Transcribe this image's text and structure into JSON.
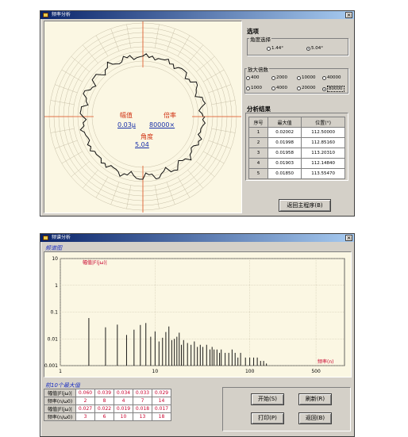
{
  "roundness_window": {
    "title": "频率分析",
    "close_label": "×",
    "polar": {
      "labels": [
        "幅值",
        "倍率",
        "角度"
      ],
      "values": [
        "0.03μ",
        "80000×",
        "5.04"
      ]
    },
    "options_title": "选项",
    "angle_group": {
      "label": "角度选择",
      "options": [
        "1.44°",
        "5.04°"
      ],
      "selected_index": 1
    },
    "magnification_group": {
      "label": "放大倍数",
      "row1": [
        "400",
        "2000",
        "10000",
        "40000"
      ],
      "row2": [
        "1000",
        "4000",
        "20000",
        "80000"
      ],
      "selected": "80000"
    },
    "results_title": "分析结果",
    "table_headers": [
      "序号",
      "最大值",
      "位置(°)"
    ],
    "table_rows": [
      [
        "1",
        "0.02002",
        "112.50000"
      ],
      [
        "2",
        "0.01998",
        "112.85160"
      ],
      [
        "3",
        "0.01958",
        "113.20310"
      ],
      [
        "4",
        "0.01903",
        "112.14840"
      ],
      [
        "5",
        "0.01850",
        "113.55470"
      ]
    ],
    "return_button": "返回主程序(B)"
  },
  "spectrum_window": {
    "title": "频谱分析",
    "close_label": "×",
    "graph_label": "频谱图",
    "top10_title": "前10个最大值",
    "row_labels": [
      "幅值|F(jω)|",
      "频率(n/ω0)",
      "幅值|F(jω)|",
      "频率(n/ω0)"
    ],
    "amp_row1": [
      "0.060",
      "0.039",
      "0.034",
      "0.033",
      "0.029"
    ],
    "freq_row1": [
      "2",
      "8",
      "4",
      "7",
      "14"
    ],
    "amp_row2": [
      "0.027",
      "0.022",
      "0.019",
      "0.018",
      "0.017"
    ],
    "freq_row2": [
      "3",
      "6",
      "10",
      "13",
      "18"
    ],
    "buttons": {
      "start": "开始(S)",
      "refresh": "刷新(R)",
      "print": "打印(P)",
      "back": "返回(B)"
    }
  },
  "chart_data": {
    "type": "bar",
    "title": "",
    "ylabel": "幅值|F(jω)|",
    "xlabel": "频率(n)",
    "x_scale": "log",
    "y_scale": "log",
    "xlim": [
      1,
      1000
    ],
    "ylim": [
      0.001,
      10
    ],
    "x_ticks": [
      "1",
      "10",
      "100",
      "500"
    ],
    "y_ticks": [
      "10",
      "1",
      "0.1",
      "0.01",
      "0.001"
    ],
    "grid": true,
    "series": [
      {
        "x": [
          2,
          3,
          4,
          5,
          6,
          7,
          8,
          9,
          10,
          11,
          12,
          13,
          14,
          15,
          16,
          17,
          18,
          19,
          20,
          22,
          24,
          26,
          28,
          30,
          32,
          35,
          38,
          40,
          42,
          45,
          48,
          50,
          55,
          60,
          65,
          70,
          75,
          80,
          90,
          100,
          110,
          120,
          130,
          140,
          150
        ],
        "values": [
          0.06,
          0.027,
          0.034,
          0.014,
          0.022,
          0.033,
          0.039,
          0.012,
          0.019,
          0.008,
          0.011,
          0.018,
          0.029,
          0.009,
          0.01,
          0.012,
          0.017,
          0.006,
          0.009,
          0.007,
          0.006,
          0.008,
          0.005,
          0.006,
          0.005,
          0.006,
          0.004,
          0.005,
          0.004,
          0.004,
          0.003,
          0.004,
          0.003,
          0.003,
          0.004,
          0.003,
          0.002,
          0.003,
          0.002,
          0.002,
          0.002,
          0.002,
          0.0015,
          0.0015,
          0.0012
        ]
      }
    ]
  }
}
